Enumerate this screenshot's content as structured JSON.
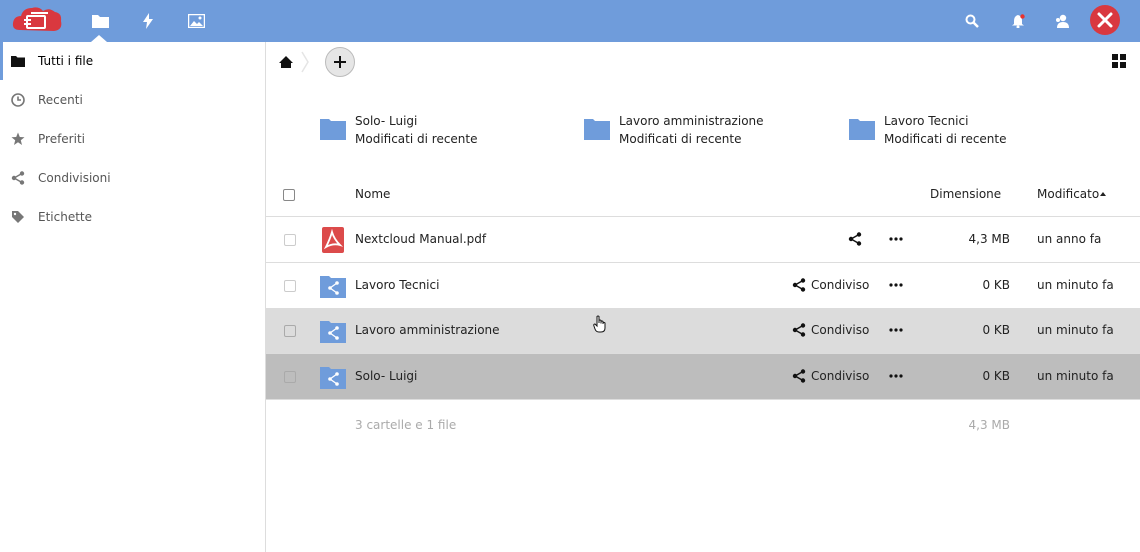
{
  "header": {
    "nav": [
      {
        "name": "files-icon",
        "active": true
      },
      {
        "name": "activity-icon",
        "active": false
      },
      {
        "name": "gallery-icon",
        "active": false
      }
    ],
    "right_icons": [
      "search-icon",
      "notifications-icon",
      "contacts-icon"
    ],
    "colors": {
      "bar": "#6f9cdb",
      "logo": "#d9383f",
      "avatar": "#d9383f"
    }
  },
  "sidebar": {
    "items": [
      {
        "label": "Tutti i file",
        "icon": "folder-icon",
        "active": true
      },
      {
        "label": "Recenti",
        "icon": "clock-icon",
        "active": false
      },
      {
        "label": "Preferiti",
        "icon": "star-icon",
        "active": false
      },
      {
        "label": "Condivisioni",
        "icon": "share-icon",
        "active": false
      },
      {
        "label": "Etichette",
        "icon": "tag-icon",
        "active": false
      }
    ]
  },
  "recent": [
    {
      "name": "Solo- Luigi",
      "subtitle": "Modificati di recente"
    },
    {
      "name": "Lavoro amministrazione",
      "subtitle": "Modificati di recente"
    },
    {
      "name": "Lavoro Tecnici",
      "subtitle": "Modificati di recente"
    }
  ],
  "table": {
    "headers": {
      "name": "Nome",
      "size": "Dimensione",
      "modified": "Modificato"
    },
    "rows": [
      {
        "name": "Nextcloud Manual.pdf",
        "type": "pdf",
        "shared_label": "",
        "size": "4,3 MB",
        "modified": "un anno fa",
        "state": "normal"
      },
      {
        "name": "Lavoro Tecnici",
        "type": "shared-folder",
        "shared_label": "Condiviso",
        "size": "0 KB",
        "modified": "un minuto fa",
        "state": "normal"
      },
      {
        "name": "Lavoro amministrazione",
        "type": "shared-folder",
        "shared_label": "Condiviso",
        "size": "0 KB",
        "modified": "un minuto fa",
        "state": "hover"
      },
      {
        "name": "Solo- Luigi",
        "type": "shared-folder",
        "shared_label": "Condiviso",
        "size": "0 KB",
        "modified": "un minuto fa",
        "state": "selected"
      }
    ],
    "summary": {
      "text": "3 cartelle e 1 file",
      "size": "4,3 MB"
    }
  }
}
